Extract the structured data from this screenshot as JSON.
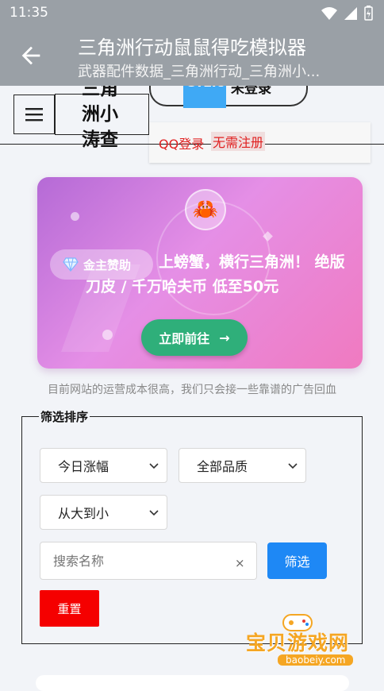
{
  "status": {
    "time": "11:35"
  },
  "appbar": {
    "title": "三角洲行动鼠鼠得吃模拟器",
    "subtitle": "武器配件数据_三角洲行动_三角洲小..."
  },
  "header": {
    "site_title": "三角洲小涛查",
    "logo_text": "Orzice",
    "login_status": "未登录",
    "qq_login": "QQ登录",
    "no_register": "无需注册"
  },
  "banner": {
    "sponsor_label": "金主赞助",
    "text": "上螃蟹，横行三角洲！ 绝版刀皮 / 千万哈夫币 低至50元",
    "go_label": "立即前往",
    "go_arrow": "→"
  },
  "ad_note": "目前网站的运营成本很高，我们只会接一些靠谱的广告回血",
  "filter": {
    "legend": "筛选排序",
    "sort_value": "今日涨幅",
    "quality_value": "全部品质",
    "order_value": "从大到小",
    "search_placeholder": "搜索名称",
    "clear_glyph": "×",
    "filter_label": "筛选",
    "reset_label": "重置"
  },
  "watermark": {
    "name": "宝贝游戏网",
    "url": "baobeiy.com"
  },
  "colors": {
    "appbar": "#9aa0a6",
    "primary": "#1e88f5",
    "danger": "#f50000",
    "go": "#2faf7a"
  }
}
